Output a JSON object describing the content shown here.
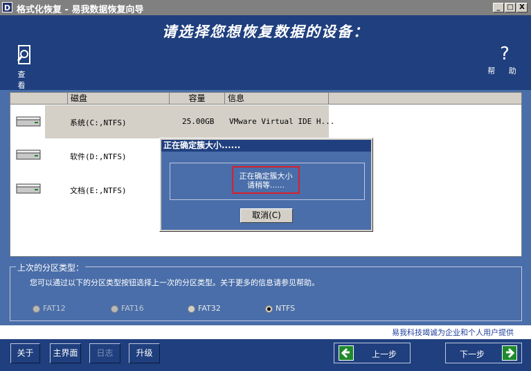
{
  "window": {
    "icon_letter": "D",
    "title": "格式化恢复 - 易我数据恢复向导",
    "minimize": "_",
    "maximize": "□",
    "close": "X"
  },
  "header": {
    "headline": "请选择您想恢复数据的设备：",
    "view_label": "查 看",
    "help_label": "帮 助",
    "help_glyph": "?"
  },
  "disk_list": {
    "columns": [
      "磁盘",
      "容量",
      "信息"
    ],
    "rows": [
      {
        "name": "系统(C:,NTFS)",
        "size": "25.00GB",
        "info": "VMware Virtual IDE H..."
      },
      {
        "name": "软件(D:,NTFS)",
        "size": "",
        "info": ""
      },
      {
        "name": "文档(E:,NTFS)",
        "size": "",
        "info": ""
      }
    ]
  },
  "dialog": {
    "title": "正在确定簇大小......",
    "message_line1": "正在确定簇大小",
    "message_line2": "请稍等......",
    "cancel_label": "取消(C)"
  },
  "partition_group": {
    "legend": "上次的分区类型：",
    "description": "您可以通过以下的分区类型按钮选择上一次的分区类型。关于更多的信息请参见帮助。",
    "options": [
      {
        "label": "FAT12",
        "selected": false
      },
      {
        "label": "FAT16",
        "selected": false
      },
      {
        "label": "FAT32",
        "selected": false
      },
      {
        "label": "NTFS",
        "selected": true
      }
    ]
  },
  "footer": {
    "slogan": "易我科技竭诚为企业和个人用户提供"
  },
  "buttons": {
    "about": "关于",
    "main": "主界面",
    "log": "日志",
    "upgrade": "升级",
    "prev": "上一步",
    "next": "下一步"
  },
  "colors": {
    "accent": "#1f3f7e",
    "panel": "#4a6ea9",
    "highlight": "#d8202a"
  }
}
